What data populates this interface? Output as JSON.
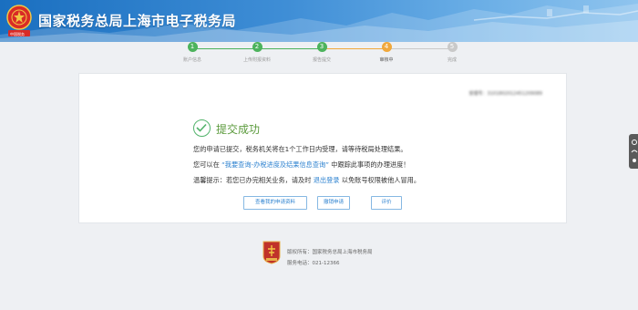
{
  "header": {
    "title": "国家税务总局上海市电子税务局",
    "emblem_icon": "tax-bureau-emblem-icon",
    "emblem_text": "中国税务"
  },
  "progress": {
    "steps": [
      {
        "number": "1",
        "label": "账户信息",
        "state": "done"
      },
      {
        "number": "2",
        "label": "上传附报资料",
        "state": "done"
      },
      {
        "number": "3",
        "label": "报告提交",
        "state": "done"
      },
      {
        "number": "4",
        "label": "审核中",
        "state": "current"
      },
      {
        "number": "5",
        "label": "完成",
        "state": "pending"
      }
    ],
    "colors": {
      "done": "#4cb35c",
      "current": "#f0a83c",
      "pending": "#c9c9c9"
    }
  },
  "card": {
    "acceptance_no": "受理号：3101802012451209089",
    "success_title": "提交成功",
    "line1": "您的申请已提交，税务机关将在1个工作日内受理，请等待税局处理结果。",
    "line2_prefix": "您可以在",
    "line2_link": "“我要查询-办税进度及结果信息查询”",
    "line2_suffix": "中跟踪此事项的办理进度！",
    "line3_prefix": "温馨提示：若您已办完相关业务，请及时",
    "line3_link": "退出登录",
    "line3_suffix": "以免账号权限被他人冒用。",
    "buttons": {
      "view_materials": "查看我的申请资料",
      "revoke": "撤销申请",
      "evaluate": "评价"
    }
  },
  "footer": {
    "copyright": "版权所有：国家税务总局上海市税务局",
    "hotline": "服务电话：021-12366"
  },
  "colors": {
    "accent": "#2f83d0",
    "success": "#5b9a3c",
    "header": "#1a6fc0"
  }
}
